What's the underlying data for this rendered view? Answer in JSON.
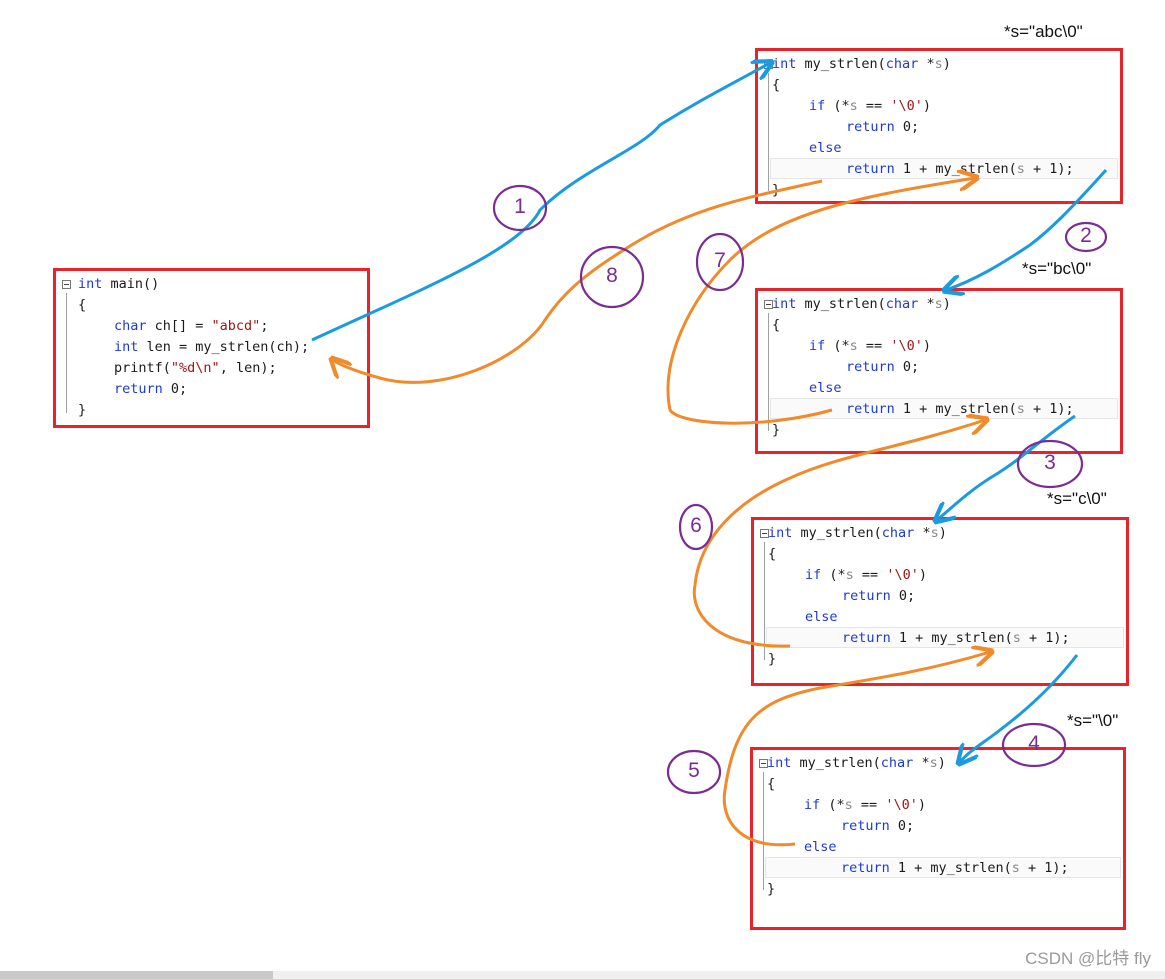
{
  "main_box": {
    "lines": [
      "int main()",
      "{",
      "char ch[] = \"abcd\";",
      "int len = my_strlen(ch);",
      "printf(\"%d\\n\", len);",
      "return 0;",
      "}"
    ]
  },
  "strlen_code": {
    "l1_kw": "int",
    "l1_fn": " my_strlen(",
    "l1_char": "char",
    "l1_star": " *",
    "l1_s": "s",
    "l1_close": ")",
    "l2": "{",
    "l3_if": "if",
    "l3_a": " (*",
    "l3_s": "s",
    "l3_b": " == ",
    "l3_c": "'\\0'",
    "l3_d": ")",
    "l4_ret": "return",
    "l4_rest": " 0;",
    "l5_else": "else",
    "l6_ret": "return",
    "l6_a": " 1 + my_strlen(",
    "l6_s": "s",
    "l6_b": " + 1);",
    "l7": "}"
  },
  "annotations": {
    "frame1": "*s=\"abc\\0\"",
    "frame2": "*s=\"bc\\0\"",
    "frame3": "*s=\"c\\0\"",
    "frame4": "*s=\"\\0\""
  },
  "steps": [
    "1",
    "2",
    "3",
    "4",
    "5",
    "6",
    "7",
    "8"
  ],
  "watermark": "CSDN @比特 fly",
  "colors": {
    "frame_border": "#e8232a",
    "call_arrow": "#1a9be0",
    "return_arrow": "#f08a2a",
    "step_ink": "#7a2c93",
    "keyword": "#1e3ad6",
    "string": "#a31515"
  }
}
